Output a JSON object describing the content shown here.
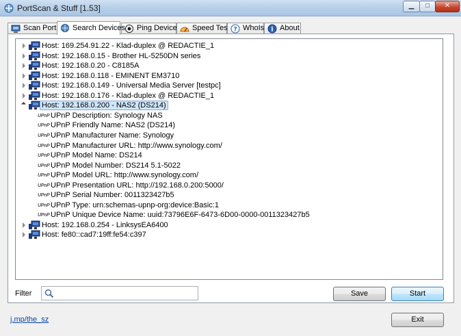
{
  "window": {
    "title": "PortScan & Stuff [1.53]",
    "controls": {
      "minimize": "▁",
      "maximize": "□",
      "close": "✕"
    }
  },
  "tabs": [
    {
      "label": "Scan Ports",
      "icon": "scan-ports-icon",
      "active": false
    },
    {
      "label": "Search Devices",
      "icon": "search-devices-icon",
      "active": true
    },
    {
      "label": "Ping Devices",
      "icon": "ping-icon",
      "active": false
    },
    {
      "label": "Speed Test",
      "icon": "speed-test-icon",
      "active": false
    },
    {
      "label": "WhoIs",
      "icon": "help-icon",
      "active": false
    },
    {
      "label": "About",
      "icon": "info-icon",
      "active": false
    }
  ],
  "tree": {
    "hosts_before": [
      "Host: 169.254.91.22 - Klad-duplex @ REDACTIE_1",
      "Host: 192.168.0.15 - Brother HL-5250DN series",
      "Host: 192.168.0.20 - C8185A",
      "Host: 192.168.0.118 - EMINENT EM3710",
      "Host: 192.168.0.149 - Universal Media Server [testpc]",
      "Host: 192.168.0.176 - Klad-duplex @ REDACTIE_1"
    ],
    "expanded_host": "Host: 192.168.0.200 - NAS2 (DS214)",
    "upnp_badge": "UPnP",
    "upnp_details": [
      "UPnP Description: Synology NAS",
      "UPnP Friendly Name: NAS2 (DS214)",
      "UPnP Manufacturer Name: Synology",
      "UPnP Manufacturer URL: http://www.synology.com/",
      "UPnP Model Name: DS214",
      "UPnP Model Number: DS214 5.1-5022",
      "UPnP Model URL: http://www.synology.com/",
      "UPnP Presentation URL: http://192.168.0.200:5000/",
      "UPnP Serial Number: 0011323427b5",
      "UPnP Type: urn:schemas-upnp-org:device:Basic:1",
      "UPnP Unique Device Name: uuid:73796E6F-6473-6D00-0000-0011323427b5"
    ],
    "hosts_after": [
      "Host: 192.168.0.254 - LinksysEA6400",
      "Host: fe80::cad7:19ff:fe54:c397"
    ]
  },
  "filter": {
    "label": "Filter",
    "value": "",
    "placeholder": ""
  },
  "buttons": {
    "save": "Save",
    "start": "Start",
    "exit": "Exit"
  },
  "footer": {
    "link": "j.mp/the_sz"
  },
  "colors": {
    "selection_bg": "#cfe6fb",
    "selection_border": "#84acdd",
    "start_button": "#bee6fd",
    "link": "#0645ad"
  }
}
